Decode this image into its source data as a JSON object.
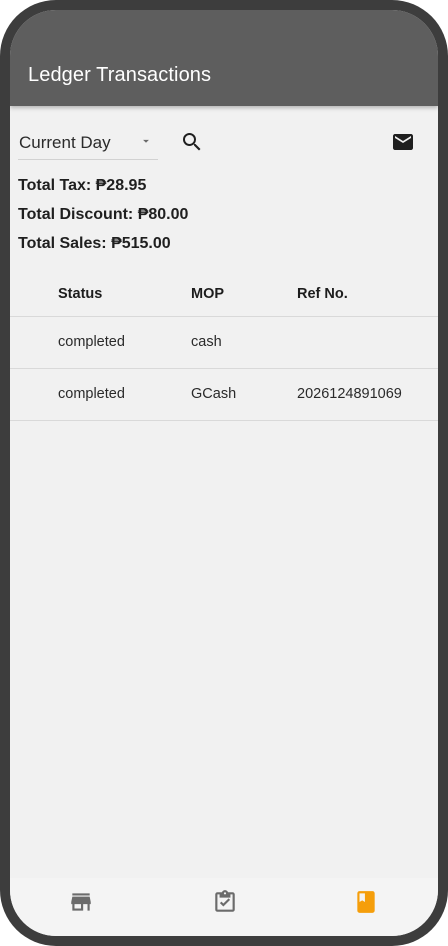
{
  "app": {
    "title": "Ledger Transactions",
    "accent_color": "#f59e0b",
    "appbar_color": "#5e5e5e"
  },
  "filters": {
    "period_value": "Current Day",
    "period_icon": "dropdown-caret-icon",
    "search_icon": "search-icon",
    "email_icon": "mail-icon"
  },
  "totals": {
    "tax": "Total Tax: ₱28.95",
    "discount": "Total Discount: ₱80.00",
    "sales": "Total Sales: ₱515.00"
  },
  "table": {
    "headers": {
      "status": "Status",
      "mop": "MOP",
      "ref": "Ref No."
    },
    "rows": [
      {
        "status": "completed",
        "mop": "cash",
        "ref": ""
      },
      {
        "status": "completed",
        "mop": "GCash",
        "ref": "2026124891069"
      }
    ]
  },
  "bottom_nav": {
    "items": [
      {
        "icon": "store-icon",
        "active": false
      },
      {
        "icon": "clipboard-check-icon",
        "active": false
      },
      {
        "icon": "book-icon",
        "active": true
      }
    ]
  }
}
